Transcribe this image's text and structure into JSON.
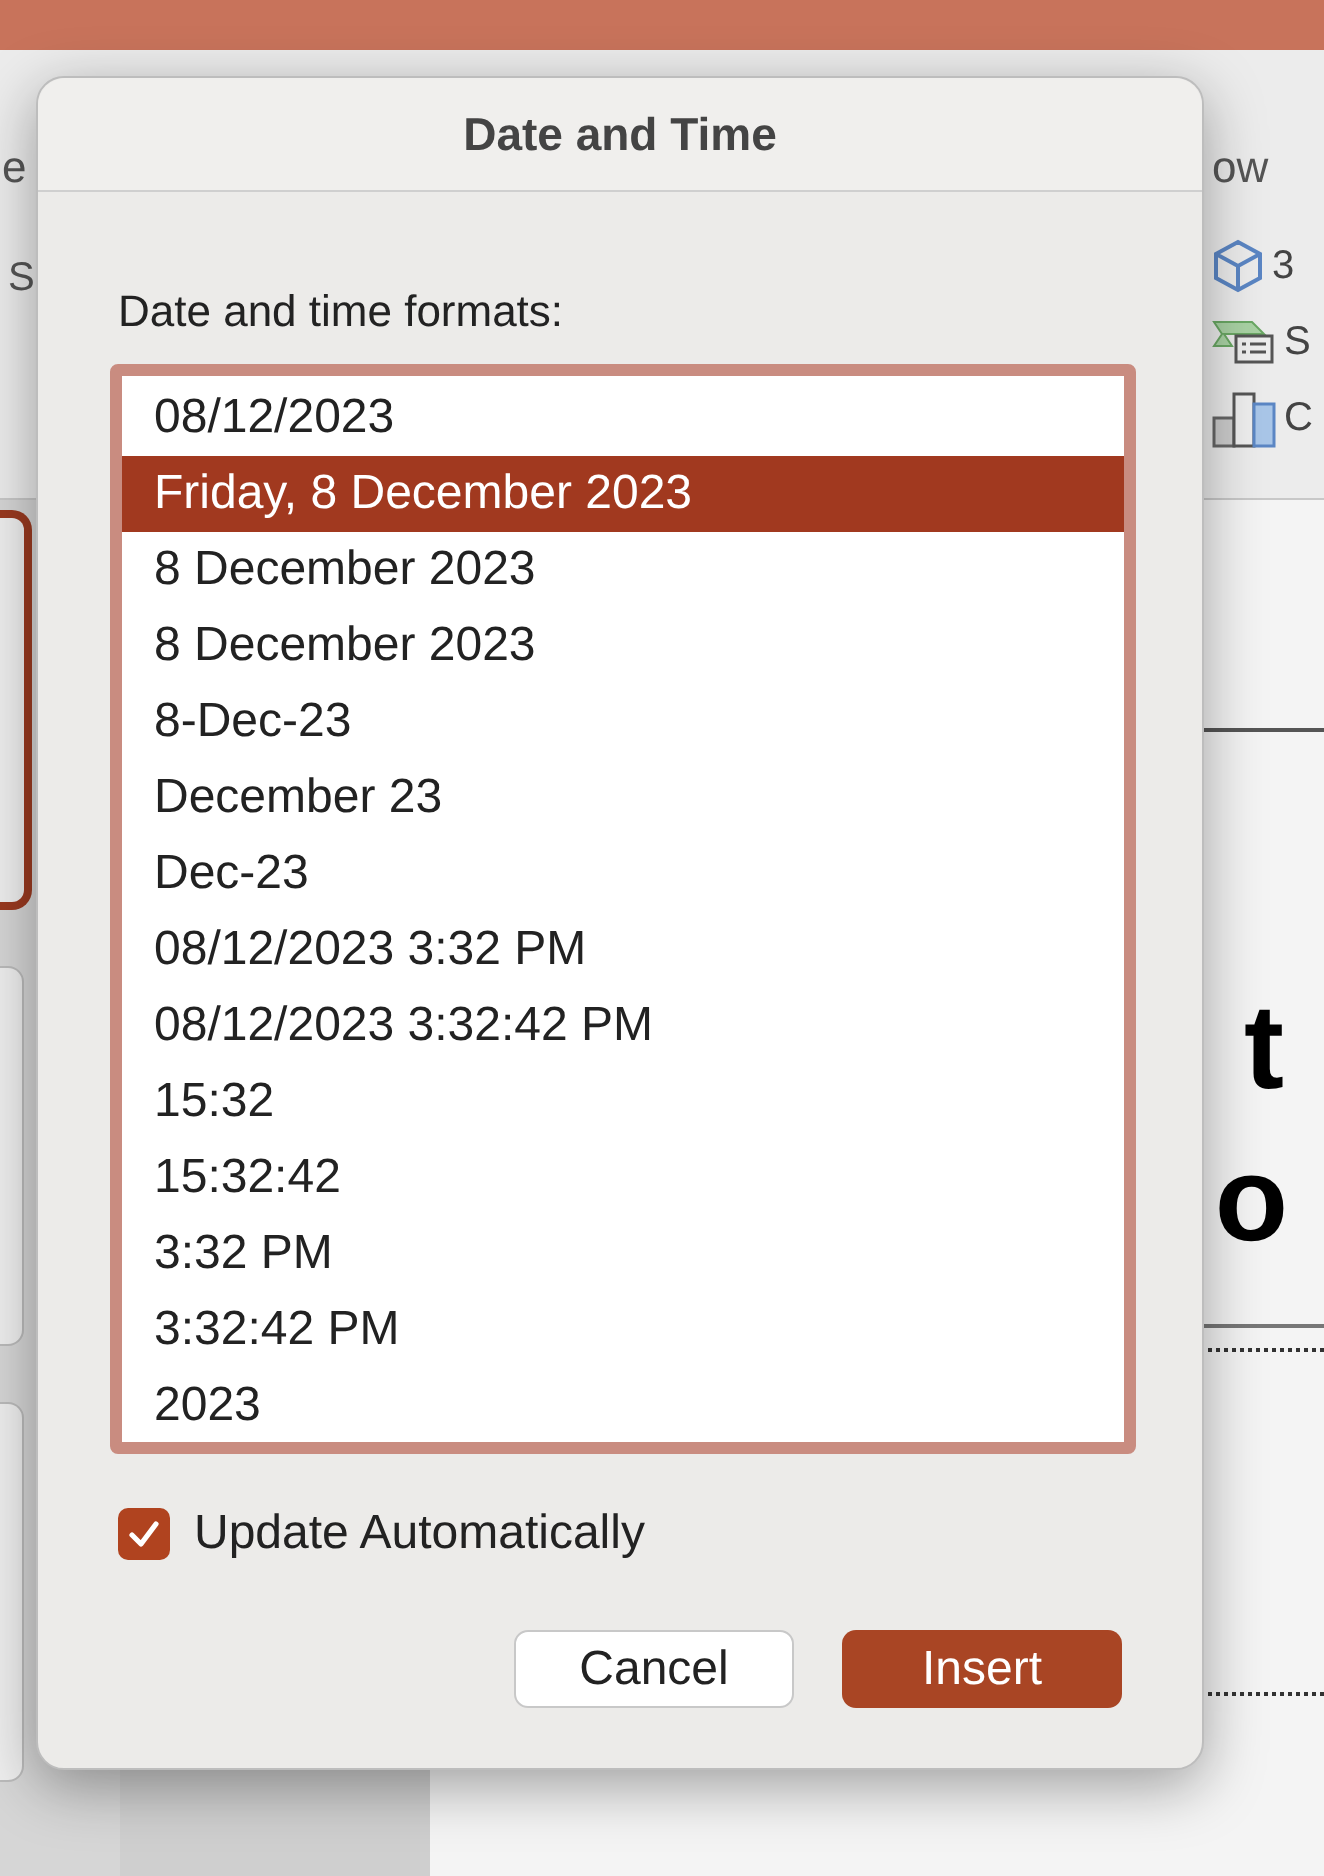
{
  "background": {
    "ribbon_left": "e",
    "ribbon_right": "ow",
    "ribbon_left_lower": "S",
    "gallery": [
      {
        "label": "3"
      },
      {
        "label": "S"
      },
      {
        "label": "C"
      }
    ],
    "slide_lines": [
      "t",
      "o"
    ]
  },
  "dialog": {
    "title": "Date and Time",
    "list_label": "Date and time formats:",
    "formats": [
      {
        "label": "08/12/2023",
        "selected": false
      },
      {
        "label": "Friday, 8 December 2023",
        "selected": true
      },
      {
        "label": "8 December 2023",
        "selected": false
      },
      {
        "label": "8 December 2023",
        "selected": false
      },
      {
        "label": "8-Dec-23",
        "selected": false
      },
      {
        "label": "December 23",
        "selected": false
      },
      {
        "label": "Dec-23",
        "selected": false
      },
      {
        "label": "08/12/2023 3:32 PM",
        "selected": false
      },
      {
        "label": "08/12/2023 3:32:42 PM",
        "selected": false
      },
      {
        "label": "15:32",
        "selected": false
      },
      {
        "label": "15:32:42",
        "selected": false
      },
      {
        "label": "3:32 PM",
        "selected": false
      },
      {
        "label": "3:32:42 PM",
        "selected": false
      },
      {
        "label": "2023",
        "selected": false
      }
    ],
    "update_automatically": {
      "label": "Update Automatically",
      "checked": true
    },
    "buttons": [
      {
        "label": "Cancel",
        "kind": "secondary"
      },
      {
        "label": "Insert",
        "kind": "primary"
      }
    ]
  }
}
